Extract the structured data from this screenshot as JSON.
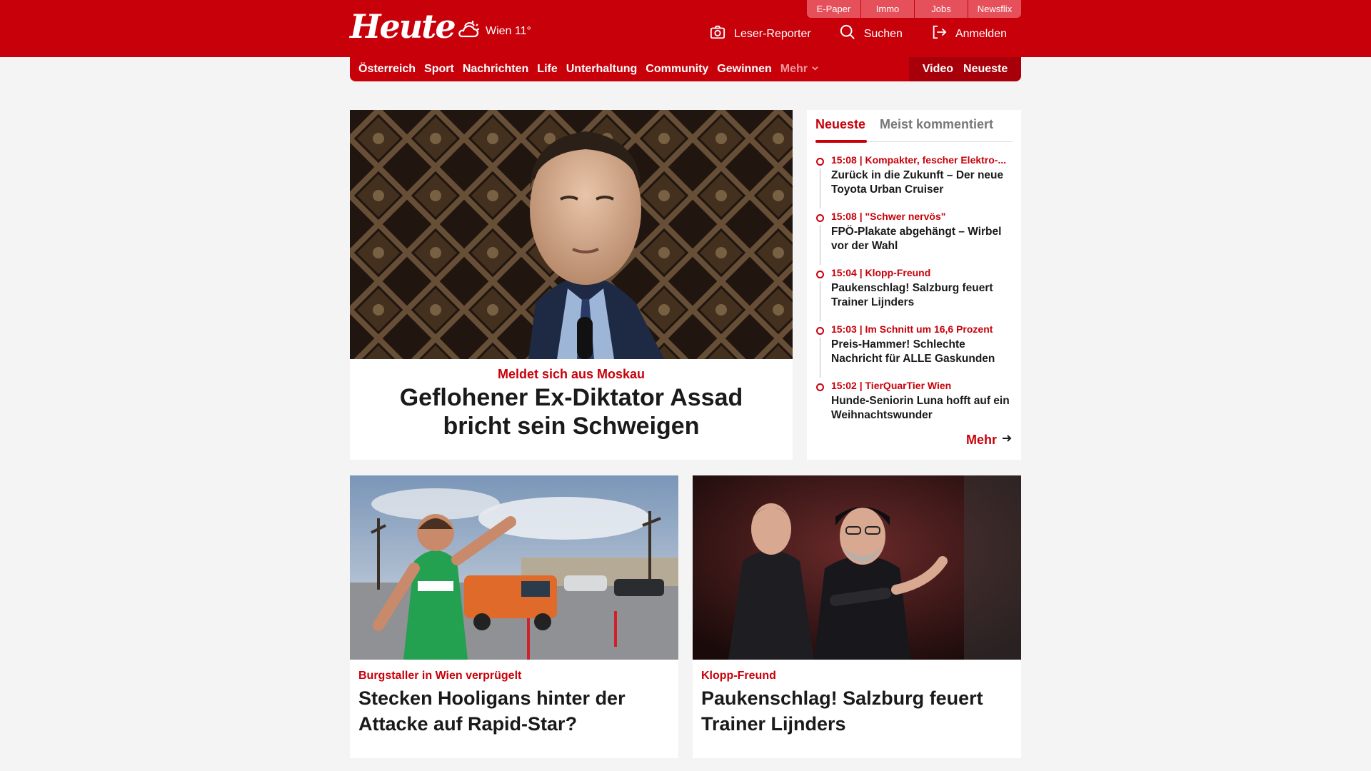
{
  "header": {
    "logo": "Heute",
    "weather": "Wien 11°",
    "util_links": [
      "E-Paper",
      "Immo",
      "Jobs",
      "Newsflix"
    ],
    "actions": {
      "reporter": "Leser-Reporter",
      "search": "Suchen",
      "login": "Anmelden"
    }
  },
  "nav": {
    "items": [
      "Österreich",
      "Sport",
      "Nachrichten",
      "Life",
      "Unterhaltung",
      "Community",
      "Gewinnen"
    ],
    "more": "Mehr",
    "video": "Video",
    "neueste": "Neueste"
  },
  "hero": {
    "kicker": "Meldet sich aus Moskau",
    "title": "Geflohener Ex-Diktator Assad bricht sein Schweigen"
  },
  "sidebar": {
    "tab_active": "Neueste",
    "tab_inactive": "Meist kommentiert",
    "items": [
      {
        "meta": "15:08 | Kompakter, fescher Elektro-...",
        "title": "Zurück in die Zukunft – Der neue Toyota Urban Cruiser"
      },
      {
        "meta": "15:08 | \"Schwer nervös\"",
        "title": "FPÖ-Plakate abgehängt – Wirbel vor der Wahl"
      },
      {
        "meta": "15:04 | Klopp-Freund",
        "title": "Paukenschlag! Salzburg feuert Trainer Lijnders"
      },
      {
        "meta": "15:03 | Im Schnitt um 16,6 Prozent",
        "title": "Preis-Hammer! Schlechte Nachricht für ALLE Gaskunden"
      },
      {
        "meta": "15:02 | TierQuarTier Wien",
        "title": "Hunde-Seniorin Luna hofft auf ein Weihnachtswunder"
      }
    ],
    "more": "Mehr"
  },
  "cards": [
    {
      "kicker": "Burgstaller in Wien verprügelt",
      "title": "Stecken Hooligans hinter der Attacke auf Rapid-Star?"
    },
    {
      "kicker": "Klopp-Freund",
      "title": "Paukenschlag! Salzburg feuert Trainer Lijnders"
    }
  ],
  "colors": {
    "brand_red": "#c8000a",
    "page_bg": "#f4f4f4"
  },
  "icons": [
    "cloud-sun-icon",
    "camera-icon",
    "search-icon",
    "login-icon",
    "chevron-down-icon",
    "arrow-right-icon"
  ]
}
